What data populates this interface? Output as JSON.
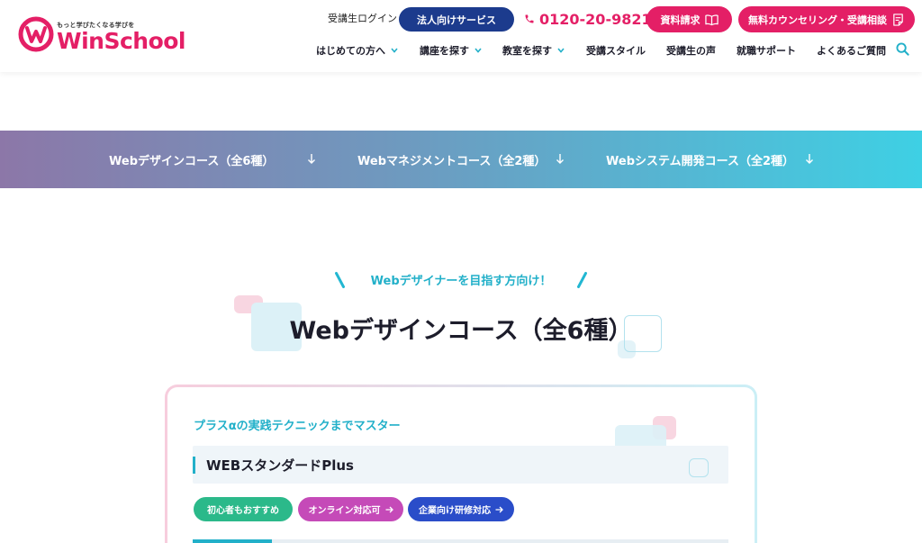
{
  "header": {
    "logo": {
      "tagline": "もっと学びたくなる学びを",
      "name": "WinSchool"
    },
    "login_label": "受講生ログイン",
    "corporate_button": "法人向けサービス",
    "phone": "0120-20-9821",
    "document_button": "資料請求",
    "counseling_button": "無料カウンセリング・受講相談",
    "nav": [
      {
        "label": "はじめての方へ",
        "dropdown": true
      },
      {
        "label": "講座を探す",
        "dropdown": true
      },
      {
        "label": "教室を探す",
        "dropdown": true
      },
      {
        "label": "受講スタイル",
        "dropdown": false
      },
      {
        "label": "受講生の声",
        "dropdown": false
      },
      {
        "label": "就職サポート",
        "dropdown": false
      },
      {
        "label": "よくあるご質問",
        "dropdown": false
      }
    ]
  },
  "anchor_band": {
    "links": [
      "Webデザインコース（全6種）",
      "Webマネジメントコース（全2種）",
      "Webシステム開発コース（全2種）"
    ]
  },
  "section": {
    "eyebrow": "Webデザイナーを目指す方向け！",
    "title": "Webデザインコース（全6種）"
  },
  "course_card": {
    "catch": "プラスαの実践テクニックまでマスター",
    "name": "WEBスタンダードPlus",
    "tags": [
      "初心者もおすすめ",
      "オンライン対応可",
      "企業向け研修対応"
    ]
  },
  "colors": {
    "brand_pink": "#e41f66",
    "navy": "#1c3b8d",
    "accent_cyan": "#22b0c9",
    "tag_green": "#2bb98a",
    "tag_purple": "#c54ab8",
    "tag_blue": "#2a4dc9"
  },
  "icons": {
    "phone": "phone-icon",
    "document": "book-icon",
    "counseling": "memo-icon",
    "search": "search-icon",
    "dropdown": "chevron-down-icon",
    "anchor": "arrow-down-icon",
    "tag": "arrow-right-icon"
  }
}
